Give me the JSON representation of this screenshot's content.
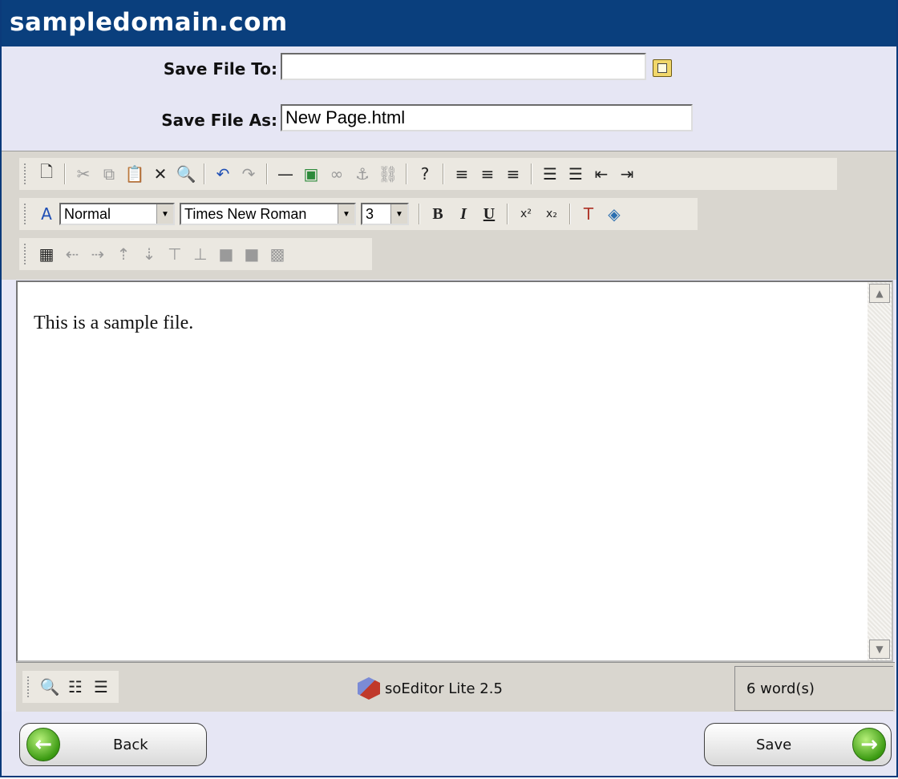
{
  "window": {
    "title": "sampledomain.com"
  },
  "form": {
    "save_to_label": "Save File To:",
    "save_to_value": "",
    "save_as_label": "Save File As:",
    "save_as_value": "New Page.html"
  },
  "toolbar": {
    "row1": {
      "file_icons": [
        "new-document-icon"
      ],
      "edit_icons": [
        "cut-icon",
        "copy-icon",
        "paste-icon",
        "delete-icon",
        "find-icon"
      ],
      "history_icons": [
        "undo-icon",
        "redo-icon"
      ],
      "insert_icons": [
        "horizontal-rule-icon",
        "insert-image-icon",
        "link-icon",
        "anchor-icon",
        "unlink-icon"
      ],
      "help_icons": [
        "help-icon"
      ],
      "align_icons": [
        "align-left-icon",
        "align-center-icon",
        "align-right-icon"
      ],
      "list_icons": [
        "ordered-list-icon",
        "unordered-list-icon",
        "outdent-icon",
        "indent-icon"
      ]
    },
    "row2": {
      "style_value": "Normal",
      "font_value": "Times New Roman",
      "size_value": "3",
      "bold": "B",
      "italic": "I",
      "underline": "U",
      "superscript": "x²",
      "subscript": "x₂"
    },
    "row3": {
      "table_icons": [
        "insert-table-icon",
        "insert-column-before-icon",
        "insert-column-after-icon",
        "insert-row-before-icon",
        "insert-row-after-icon",
        "merge-up-icon",
        "merge-down-icon",
        "delete-row-icon",
        "delete-column-icon",
        "table-properties-icon"
      ]
    }
  },
  "editor": {
    "content": "This is a sample file."
  },
  "statusbar": {
    "view_icons": [
      "preview-icon",
      "source-view-icon",
      "properties-icon"
    ],
    "brand": "soEditor Lite 2.5",
    "word_count": "6 word(s)"
  },
  "buttons": {
    "back_label": "Back",
    "save_label": "Save"
  },
  "colors": {
    "title_bar": "#0a3f7d",
    "form_bg": "#e6e6f4",
    "toolbar_bg": "#d9d6cf",
    "button_green": "#3c9b13"
  }
}
